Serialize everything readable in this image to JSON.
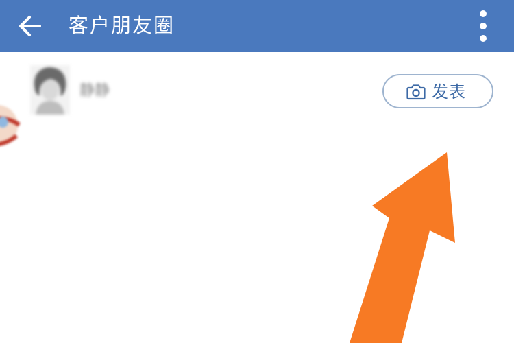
{
  "app_bar": {
    "title": "客户朋友圈",
    "background_color": "#4a79be",
    "back_icon": "arrow-left-icon",
    "more_icon": "more-vertical-icon"
  },
  "profile": {
    "avatar_icon": "avatar-image",
    "name": "静静"
  },
  "publish_button": {
    "icon": "camera-icon",
    "label": "发表",
    "accent_color": "#3d6aa6"
  },
  "overlay": {
    "annotation_icon": "pointer-arrow-icon",
    "color": "#f77a24"
  }
}
